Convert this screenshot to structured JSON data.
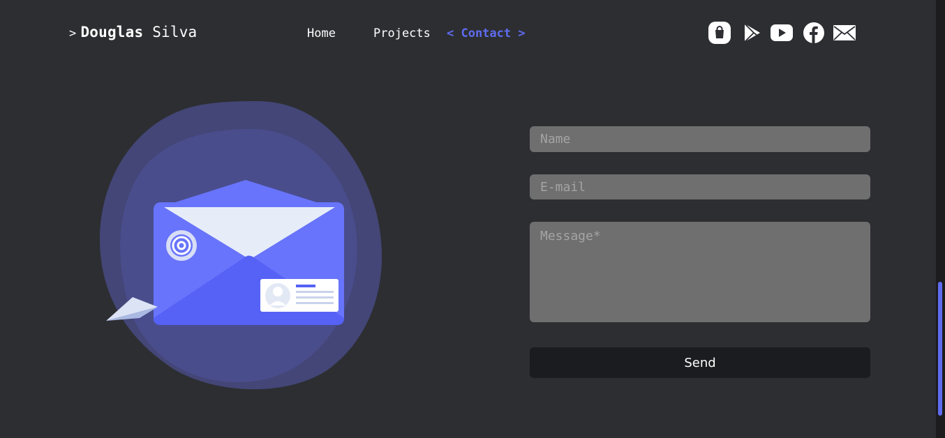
{
  "logo": {
    "prompt": ">",
    "first_name": "Douglas",
    "last_name": "Silva"
  },
  "nav": {
    "home": "Home",
    "projects": "Projects",
    "contact": "< Contact >"
  },
  "social": [
    "shopping-bag-icon",
    "play-store-icon",
    "youtube-icon",
    "facebook-icon",
    "mail-icon"
  ],
  "form": {
    "name_placeholder": "Name",
    "email_placeholder": "E-mail",
    "message_placeholder": "Message*",
    "send_label": "Send"
  },
  "colors": {
    "background": "#2d2e32",
    "accent": "#5f6cf0",
    "field": "#6f6f6f",
    "button": "#1b1c1f",
    "blob": "#434676",
    "envelope": "#6874fb",
    "envelope_dark": "#5662f5",
    "letter": "#e7edf8"
  }
}
